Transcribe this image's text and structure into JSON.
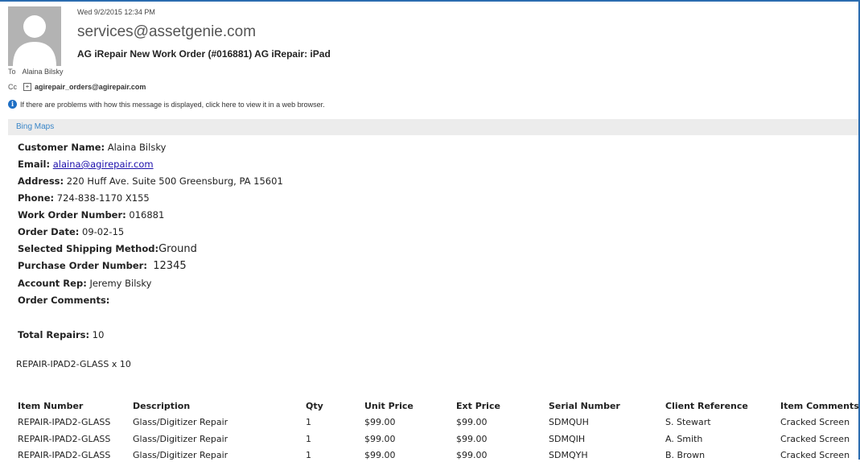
{
  "header": {
    "date": "Wed 9/2/2015 12:34 PM",
    "from": "services@assetgenie.com",
    "subject": "AG iRepair New Work Order (#016881) AG iRepair: iPad",
    "to_label": "To",
    "to_value": "Alaina Bilsky",
    "cc_label": "Cc",
    "cc_value": "agirepair_orders@agirepair.com",
    "info_text": "If there are problems with how this message is displayed, click here to view it in a web browser."
  },
  "bing_maps_label": "Bing Maps",
  "order": {
    "customer_name_label": "Customer Name:",
    "customer_name": "Alaina Bilsky",
    "email_label": "Email:",
    "email": "alaina@agirepair.com",
    "address_label": "Address:",
    "address": "220 Huff Ave. Suite 500 Greensburg, PA 15601",
    "phone_label": "Phone:",
    "phone": "724-838-1170 X155",
    "work_order_label": "Work Order Number:",
    "work_order": "016881",
    "order_date_label": "Order Date:",
    "order_date": "09-02-15",
    "shipping_label": "Selected Shipping Method:",
    "shipping": "Ground",
    "po_label": "Purchase Order Number:",
    "po": "12345",
    "rep_label": "Account Rep:",
    "rep": "Jeremy Bilsky",
    "comments_label": "Order Comments:",
    "total_label": "Total Repairs:",
    "total": "10",
    "summary_line": "REPAIR-IPAD2-GLASS x 10"
  },
  "table": {
    "headers": [
      "Item Number",
      "Description",
      "Qty",
      "Unit Price",
      "Ext Price",
      "Serial Number",
      "Client Reference",
      "Item Comments"
    ],
    "rows": [
      [
        "REPAIR-IPAD2-GLASS",
        "Glass/Digitizer Repair",
        "1",
        "$99.00",
        "$99.00",
        "SDMQUH",
        "S. Stewart",
        "Cracked Screen"
      ],
      [
        "REPAIR-IPAD2-GLASS",
        "Glass/Digitizer Repair",
        "1",
        "$99.00",
        "$99.00",
        "SDMQIH",
        "A. Smith",
        "Cracked Screen"
      ],
      [
        "REPAIR-IPAD2-GLASS",
        "Glass/Digitizer Repair",
        "1",
        "$99.00",
        "$99.00",
        "SDMQYH",
        "B. Brown",
        "Cracked Screen"
      ]
    ]
  }
}
